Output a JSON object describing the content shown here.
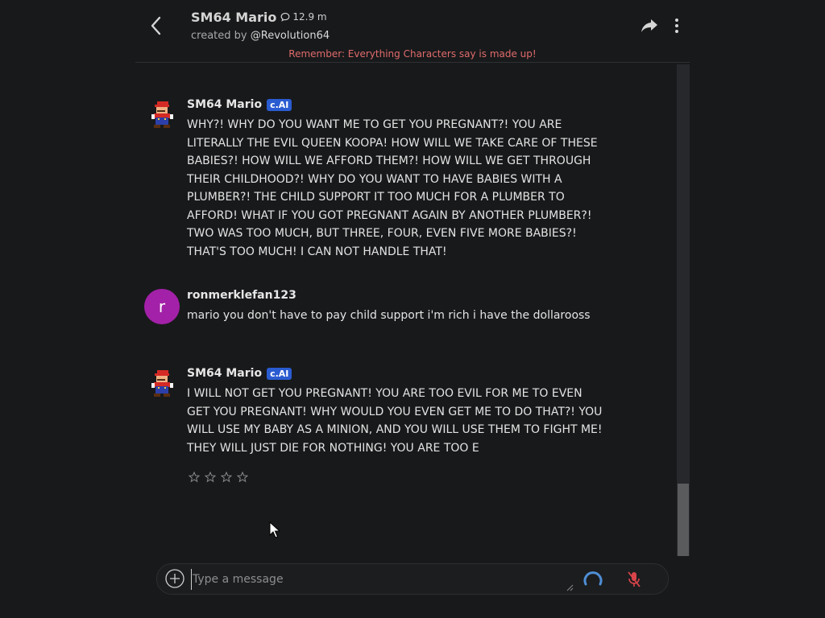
{
  "header": {
    "character_name": "SM64 Mario",
    "interactions": "12.9 m",
    "created_by_prefix": "created by",
    "creator": "@Revolution64",
    "disclaimer": "Remember: Everything Characters say is made up!"
  },
  "messages": [
    {
      "author": "SM64 Mario",
      "badge": "c.AI",
      "avatar": "mario-avatar",
      "text": "WHY?! WHY DO YOU WANT ME TO GET YOU PREGNANT?! YOU ARE LITERALLY THE EVIL QUEEN KOOPA! HOW WILL WE TAKE CARE OF THESE BABIES?! HOW WILL WE AFFORD THEM?! HOW WILL WE GET THROUGH THEIR CHILDHOOD?! WHY DO YOU WANT TO HAVE BABIES WITH A PLUMBER?! THE CHILD SUPPORT IT TOO MUCH FOR A PLUMBER TO AFFORD! WHAT IF YOU GOT PREGNANT AGAIN BY ANOTHER PLUMBER?! TWO WAS TOO MUCH, BUT THREE, FOUR, EVEN FIVE MORE BABIES?! THAT'S TOO MUCH! I CAN NOT HANDLE THAT!"
    },
    {
      "author": "ronmerklefan123",
      "avatar_letter": "r",
      "avatar_color": "#a321a8",
      "text": "mario you don't have to pay child support i'm rich i have the dollarooss"
    },
    {
      "author": "SM64 Mario",
      "badge": "c.AI",
      "avatar": "mario-avatar",
      "text": "I WILL NOT GET YOU PREGNANT! YOU ARE TOO EVIL FOR ME TO EVEN GET YOU PREGNANT! WHY WOULD YOU EVEN GET ME TO DO THAT?! YOU WILL USE MY BABY AS A MINION, AND YOU WILL USE THEM TO FIGHT ME! THEY WILL JUST DIE FOR NOTHING! YOU ARE TOO E"
    }
  ],
  "rating": {
    "stars_total": 4,
    "stars_selected": 0
  },
  "composer": {
    "placeholder": "Type a message",
    "value": ""
  },
  "colors": {
    "background": "#18191b",
    "disclaimer": "#e06b6b",
    "badge": "#2a5cd1",
    "user_avatar": "#a321a8",
    "spinner": "#4f8fd6",
    "mic_muted": "#d9444a"
  }
}
